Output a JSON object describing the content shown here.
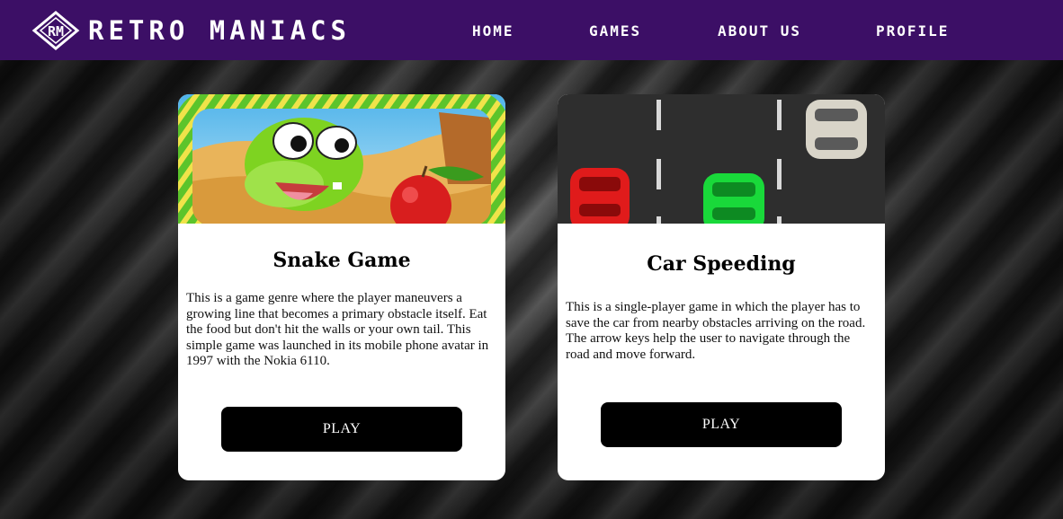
{
  "brand": {
    "logo_text": "RM",
    "name": "RETRO MANIACS"
  },
  "nav": {
    "home": "HOME",
    "games": "GAMES",
    "about": "ABOUT US",
    "profile": "PROFILE"
  },
  "cards": [
    {
      "title": "Snake Game",
      "description": "This is a game genre where the player maneuvers a growing line that becomes a primary obstacle itself. Eat the food but don't hit the walls or your own tail. This simple game was launched in its mobile phone avatar in 1997 with the Nokia 6110.",
      "button": "PLAY",
      "image": "snake-apple-illustration"
    },
    {
      "title": "Car Speeding",
      "description": "This is a single-player game in which the player has to save the car from nearby obstacles arriving on the road. The arrow keys help the user to navigate through the road and move forward.",
      "button": "PLAY",
      "image": "top-down-road-cars"
    }
  ],
  "colors": {
    "navbar": "#3c0f66",
    "card": "#ffffff",
    "button": "#000000",
    "red_car": "#e01b1b",
    "green_car": "#19d93a"
  }
}
